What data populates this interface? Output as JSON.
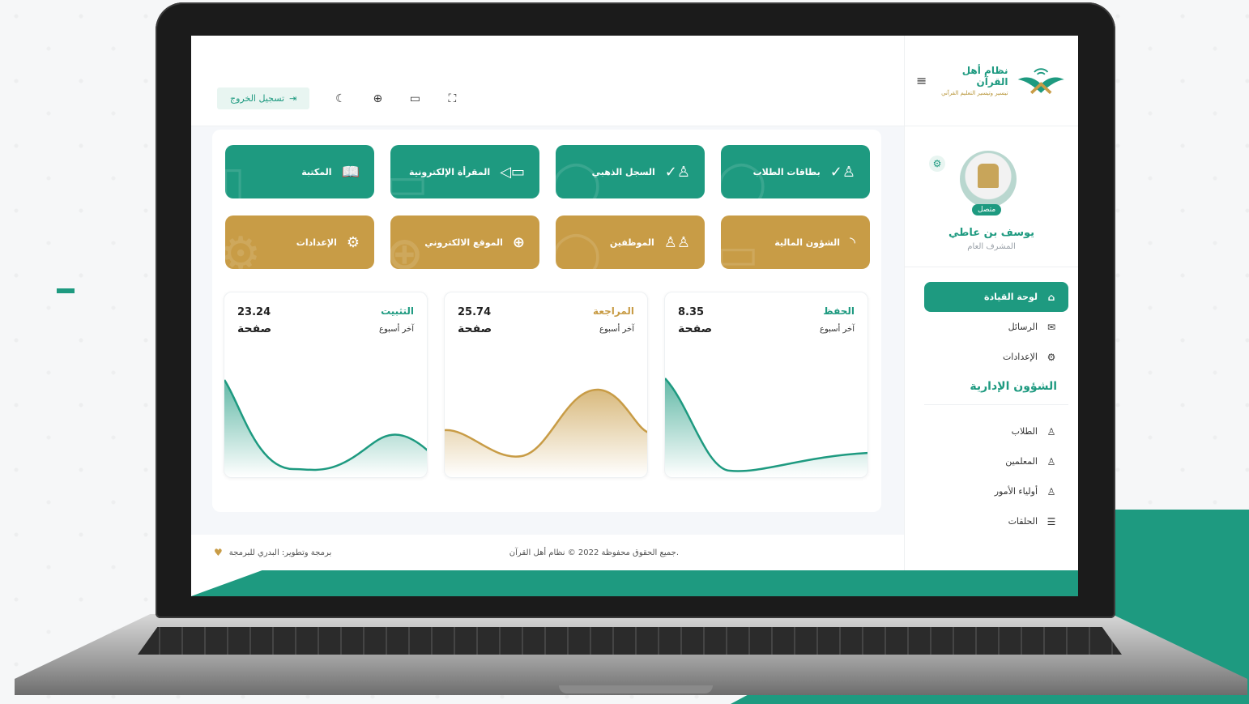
{
  "brand": {
    "name": "نظام أهل القرآن",
    "tagline": "تيسير وتيسير التعليم القرآني"
  },
  "topbar": {
    "logout_label": "تسجيل الخروج",
    "icons": [
      "logout-icon",
      "moon-icon",
      "globe-icon",
      "message-icon",
      "fullscreen-icon"
    ]
  },
  "profile": {
    "status": "متصل",
    "name": "يوسف بن عاطي",
    "role": "المشرف العام"
  },
  "sidebar": {
    "items": [
      {
        "label": "لوحة القيادة",
        "icon": "home-icon",
        "active": true
      },
      {
        "label": "الرسائل",
        "icon": "mail-icon",
        "active": false
      },
      {
        "label": "الإعدادات",
        "icon": "settings-icon",
        "active": false
      }
    ],
    "section_title": "الشؤون الإدارية",
    "admin_items": [
      {
        "label": "الطلاب",
        "icon": "user-icon"
      },
      {
        "label": "المعلمين",
        "icon": "user-icon"
      },
      {
        "label": "أولياء الأمور",
        "icon": "user-icon"
      },
      {
        "label": "الحلقات",
        "icon": "list-icon"
      }
    ]
  },
  "tiles": [
    {
      "label": "بطاقات الطلاب",
      "icon": "user-check-icon",
      "color": "#1e9a80"
    },
    {
      "label": "السجل الذهبي",
      "icon": "user-check-icon",
      "color": "#1e9a80"
    },
    {
      "label": "المقرأة الإلكترونية",
      "icon": "video-icon",
      "color": "#1e9a80"
    },
    {
      "label": "المكتبة",
      "icon": "book-icon",
      "color": "#1e9a80"
    },
    {
      "label": "الشؤون المالية",
      "icon": "rss-icon",
      "color": "#c89c46"
    },
    {
      "label": "الموظفين",
      "icon": "users-icon",
      "color": "#c89c46"
    },
    {
      "label": "الموقع الالكتروني",
      "icon": "globe-icon",
      "color": "#c89c46"
    },
    {
      "label": "الإعدادات",
      "icon": "gear-icon",
      "color": "#c89c46"
    }
  ],
  "stats": [
    {
      "title": "الحفظ",
      "subtitle": "آخر أسبوع",
      "value": "8.35",
      "unit": "صفحة",
      "color": "#1e9a80"
    },
    {
      "title": "المراجعة",
      "subtitle": "آخر أسبوع",
      "value": "25.74",
      "unit": "صفحة",
      "color": "#c89c46"
    },
    {
      "title": "التثبيت",
      "subtitle": "آخر أسبوع",
      "value": "23.24",
      "unit": "صفحة",
      "color": "#1e9a80"
    }
  ],
  "footer": {
    "copyright": "جميع الحقوق محفوظة 2022 © نظام أهل القرآن.",
    "credits": "برمجة وتطوير: البدري للبرمجة"
  },
  "colors": {
    "primary": "#1e9a80",
    "gold": "#c89c46"
  }
}
